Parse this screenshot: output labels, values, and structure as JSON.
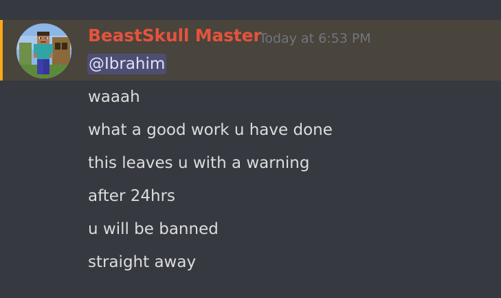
{
  "message": {
    "author": "BeastSkull Master",
    "timestamp": "Today at 6:53 PM",
    "mention": "@Ibrahim",
    "lines": [
      "waaah",
      "what a good work u have done",
      "this leaves u with a warning",
      "after 24hrs",
      "u will be banned",
      "straight away"
    ],
    "author_color": "#e5533d",
    "highlight_bar_color": "#faa81a",
    "avatar_icon": "minecraft-steve-avatar"
  }
}
